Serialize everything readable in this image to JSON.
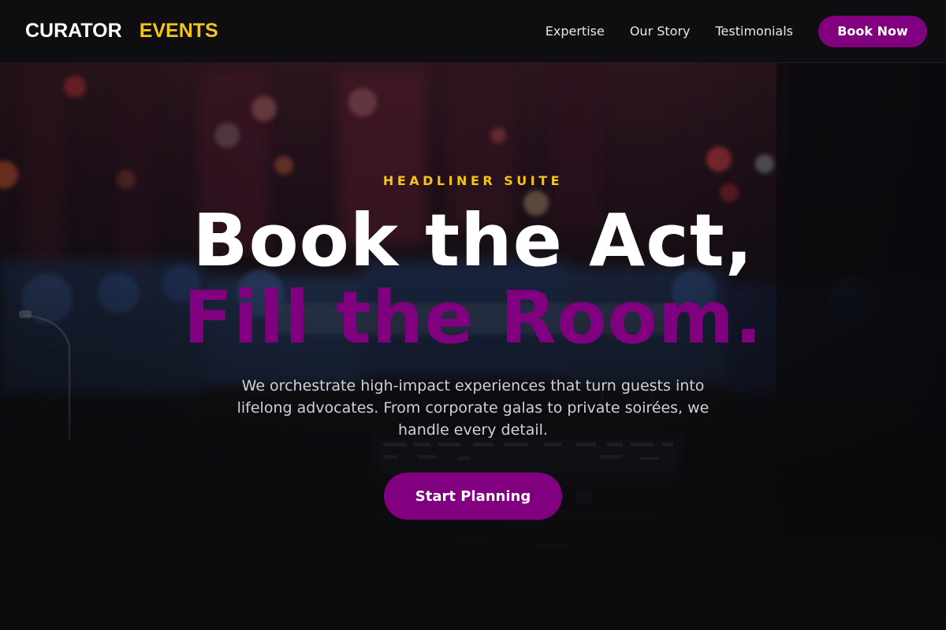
{
  "brand": {
    "word_1": "CURATOR",
    "word_2": "EVENTS"
  },
  "nav": {
    "links": [
      "Expertise",
      "Our Story",
      "Testimonials"
    ],
    "cta_label": "Book Now"
  },
  "hero": {
    "eyebrow": "HEADLINER SUITE",
    "headline_line_1": "Book the Act,",
    "headline_line_2": "Fill the Room.",
    "subtext": "We orchestrate high-impact experiences that turn guests into lifelong advocates. From corporate galas to private soirées, we handle every detail.",
    "cta_label": "Start Planning",
    "background_image": "dim concert stage with bokeh lights and mixing console"
  },
  "colors": {
    "accent_purple": "#800080",
    "accent_gold": "#f5c518",
    "background": "#0d0c0e",
    "text_primary": "#ffffff"
  }
}
